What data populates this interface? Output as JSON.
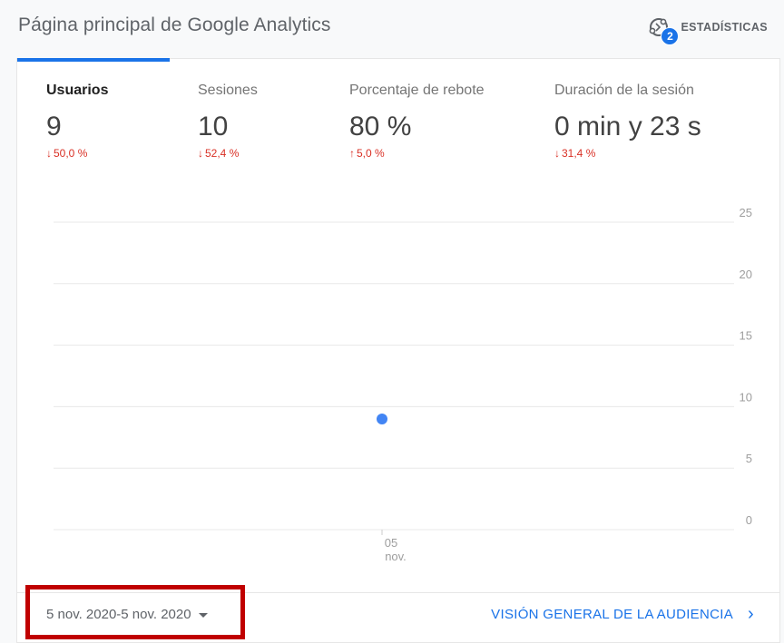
{
  "header": {
    "title": "Página principal de Google Analytics",
    "insights_label": "ESTADÍSTICAS",
    "insights_count": "2"
  },
  "metrics": [
    {
      "label": "Usuarios",
      "value": "9",
      "change": "50,0 %",
      "direction": "down",
      "active": true
    },
    {
      "label": "Sesiones",
      "value": "10",
      "change": "52,4 %",
      "direction": "down",
      "active": false
    },
    {
      "label": "Porcentaje de rebote",
      "value": "80 %",
      "change": "5,0 %",
      "direction": "up",
      "active": false
    },
    {
      "label": "Duración de la sesión",
      "value": "0 min y 23 s",
      "change": "31,4 %",
      "direction": "down",
      "active": false
    }
  ],
  "chart_data": {
    "type": "scatter",
    "x": [
      "05 nov."
    ],
    "series": [
      {
        "values": [
          9
        ]
      }
    ],
    "ylim": [
      0,
      25
    ],
    "yticks": [
      "0",
      "5",
      "10",
      "15",
      "20",
      "25"
    ],
    "xtick_labels": [
      {
        "day": "05",
        "month": "nov."
      }
    ],
    "color": "#4285f4"
  },
  "footer": {
    "date_range": "5 nov. 2020-5 nov. 2020",
    "audience_link": "VISIÓN GENERAL DE LA AUDIENCIA"
  },
  "colors": {
    "accent": "#1a73e8",
    "negative": "#d93025",
    "highlight": "#c00000"
  }
}
